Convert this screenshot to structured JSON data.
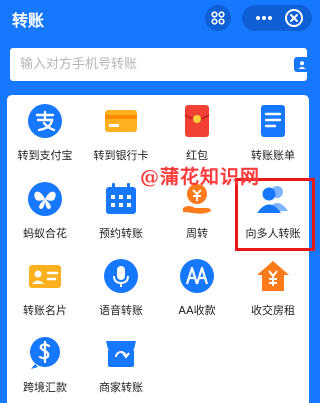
{
  "header": {
    "title": "转账"
  },
  "search": {
    "placeholder": "输入对方手机号转账"
  },
  "items": [
    {
      "label": "转到支付宝",
      "icon": "alipay-icon"
    },
    {
      "label": "转到银行卡",
      "icon": "bank-card-icon"
    },
    {
      "label": "红包",
      "icon": "red-envelope-icon"
    },
    {
      "label": "转账账单",
      "icon": "bill-icon"
    },
    {
      "label": "蚂蚁合花",
      "icon": "butterfly-icon"
    },
    {
      "label": "预约转账",
      "icon": "calendar-icon"
    },
    {
      "label": "周转",
      "icon": "coin-hand-icon"
    },
    {
      "label": "向多人转账",
      "icon": "multi-user-icon"
    },
    {
      "label": "转账名片",
      "icon": "name-card-icon"
    },
    {
      "label": "语音转账",
      "icon": "microphone-icon"
    },
    {
      "label": "AA收款",
      "icon": "aa-icon"
    },
    {
      "label": "收交房租",
      "icon": "house-icon"
    },
    {
      "label": "跨境汇款",
      "icon": "dollar-icon"
    },
    {
      "label": "商家转账",
      "icon": "shop-icon"
    }
  ],
  "watermark": "@蒲花知识网",
  "colors": {
    "brand": "#1677ff",
    "red": "#f04134",
    "orange": "#ff7a1a",
    "highlight": "#e81818"
  }
}
